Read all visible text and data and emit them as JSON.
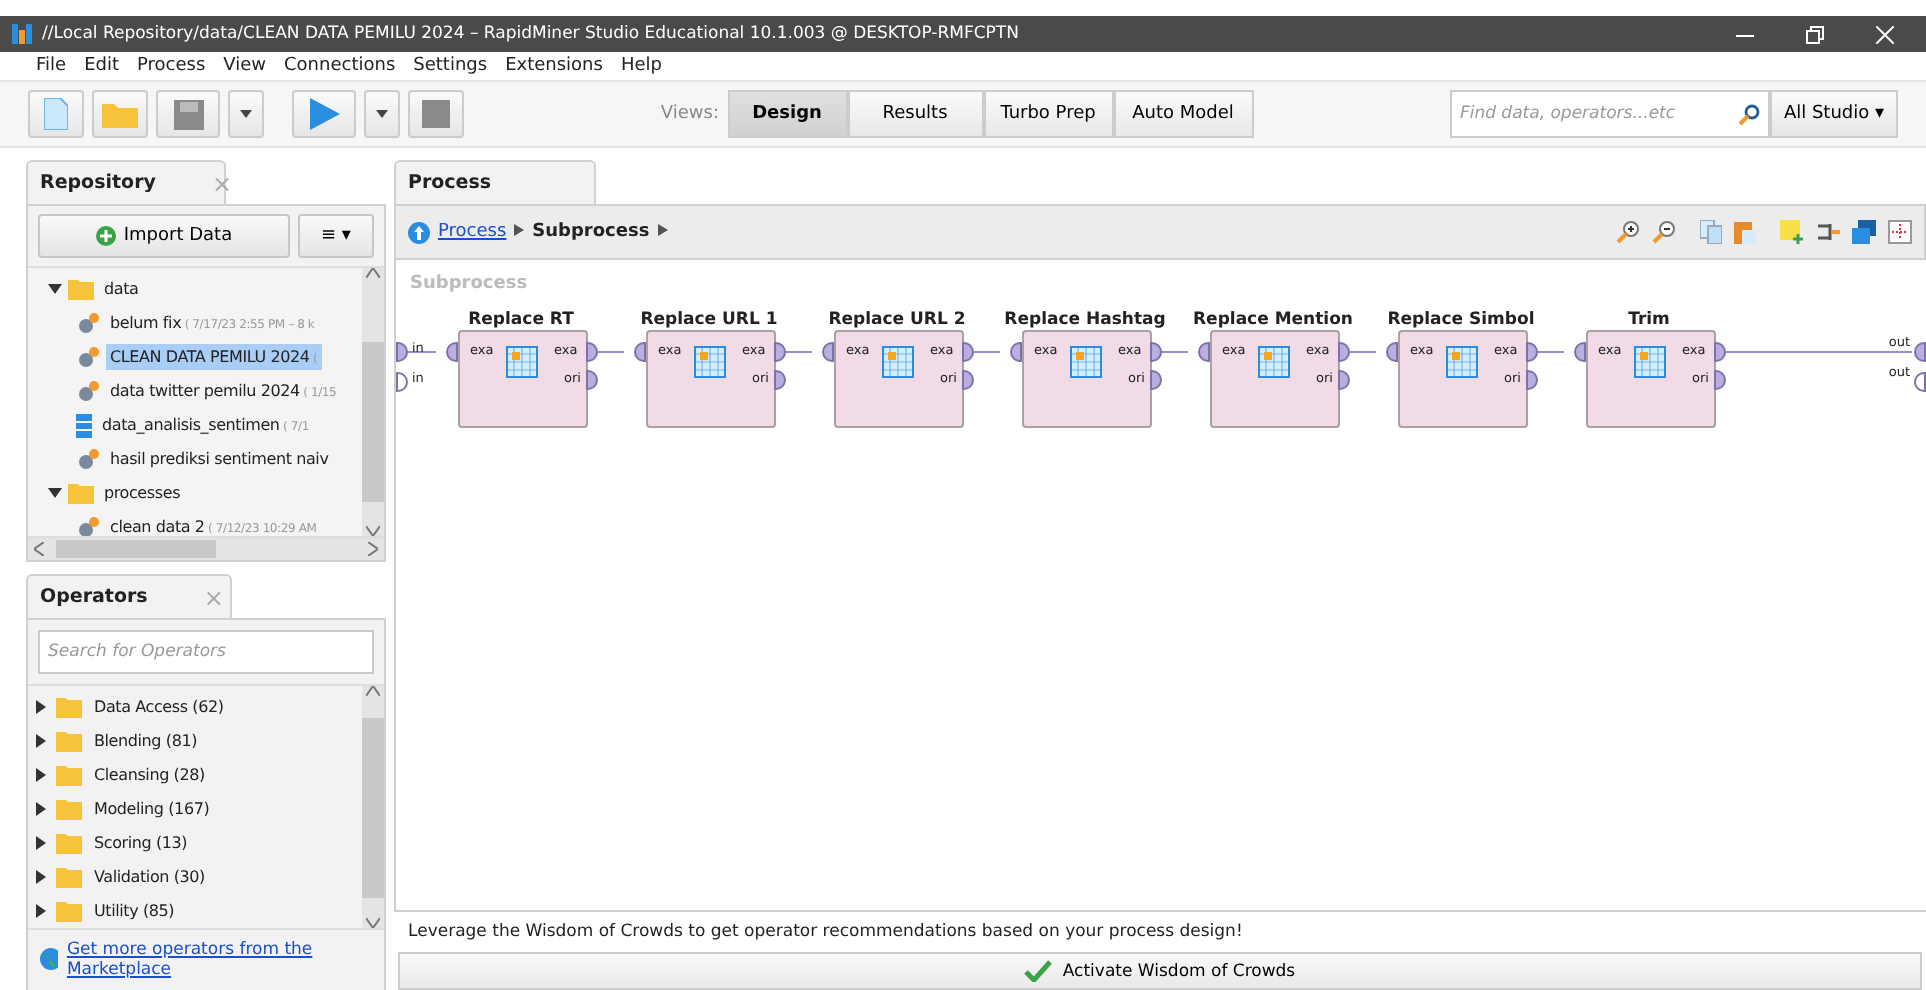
{
  "window": {
    "title": "//Local Repository/data/CLEAN DATA PEMILU 2024 – RapidMiner Studio Educational 10.1.003 @ DESKTOP-RMFCPTN"
  },
  "menu": [
    "File",
    "Edit",
    "Process",
    "View",
    "Connections",
    "Settings",
    "Extensions",
    "Help"
  ],
  "toolbar": {
    "views_label": "Views:",
    "views": [
      {
        "label": "Design",
        "selected": true
      },
      {
        "label": "Results",
        "selected": false
      },
      {
        "label": "Turbo Prep",
        "selected": false
      },
      {
        "label": "Auto Model",
        "selected": false
      }
    ],
    "search": {
      "placeholder": "Find data, operators...etc"
    },
    "scope": "All Studio ▾"
  },
  "repository": {
    "tab": "Repository",
    "close": "×",
    "import_button": "Import Data",
    "menu_button": "≡ ▾",
    "tree": [
      {
        "label": "data",
        "kind": "folder",
        "expanded": true,
        "children": [
          {
            "label": "belum fix",
            "meta": "( 7/17/23 2:55 PM – 8 k",
            "kind": "process",
            "selected": false
          },
          {
            "label": "CLEAN DATA PEMILU 2024",
            "meta": "(",
            "kind": "process",
            "selected": true
          },
          {
            "label": "data twitter pemilu 2024",
            "meta": "( 1/15",
            "kind": "process",
            "selected": false
          },
          {
            "label": "data_analisis_sentimen",
            "meta": "( 7/1",
            "kind": "data",
            "selected": false
          },
          {
            "label": "hasil prediksi sentiment naiv",
            "kind": "process",
            "selected": false
          }
        ]
      },
      {
        "label": "processes",
        "kind": "folder",
        "expanded": true,
        "children": [
          {
            "label": "clean data 2",
            "meta": "( 7/12/23 10:29 AM",
            "kind": "process",
            "selected": false
          }
        ]
      }
    ]
  },
  "operators": {
    "tab": "Operators",
    "close": "×",
    "search": {
      "placeholder": "Search for Operators"
    },
    "groups": [
      {
        "label": "Data Access (62)",
        "expanded": false
      },
      {
        "label": "Blending (81)",
        "expanded": false
      },
      {
        "label": "Cleansing (28)",
        "expanded": false
      },
      {
        "label": "Modeling (167)",
        "expanded": false
      },
      {
        "label": "Scoring (13)",
        "expanded": false
      },
      {
        "label": "Validation (30)",
        "expanded": false
      },
      {
        "label": "Utility (85)",
        "expanded": false
      }
    ],
    "marketplace_link": "Get more operators from the Marketplace"
  },
  "process": {
    "tab": "Process",
    "breadcrumb": [
      {
        "label": "Process",
        "link": true
      },
      {
        "label": "Subprocess",
        "link": false
      }
    ],
    "canvas_title": "Subprocess",
    "inputs": [
      {
        "label": "in",
        "connected": true
      },
      {
        "label": "in",
        "connected": false
      }
    ],
    "outputs": [
      {
        "label": "out",
        "connected": true
      },
      {
        "label": "out",
        "connected": false
      }
    ],
    "operators": [
      {
        "name": "Replace RT",
        "input": "exa",
        "outputs": [
          "exa",
          "ori"
        ]
      },
      {
        "name": "Replace URL 1",
        "input": "exa",
        "outputs": [
          "exa",
          "ori"
        ]
      },
      {
        "name": "Replace URL 2",
        "input": "exa",
        "outputs": [
          "exa",
          "ori"
        ]
      },
      {
        "name": "Replace Hashtag",
        "input": "exa",
        "outputs": [
          "exa",
          "ori"
        ]
      },
      {
        "name": "Replace Mention",
        "input": "exa",
        "outputs": [
          "exa",
          "ori"
        ]
      },
      {
        "name": "Replace Simbol",
        "input": "exa",
        "outputs": [
          "exa",
          "ori"
        ]
      },
      {
        "name": "Trim",
        "input": "exa",
        "outputs": [
          "exa",
          "ori"
        ]
      }
    ],
    "wisdom_text": "Leverage the Wisdom of Crowds to get operator recommendations based on your process design!",
    "wisdom_button": "Activate Wisdom of Crowds"
  }
}
